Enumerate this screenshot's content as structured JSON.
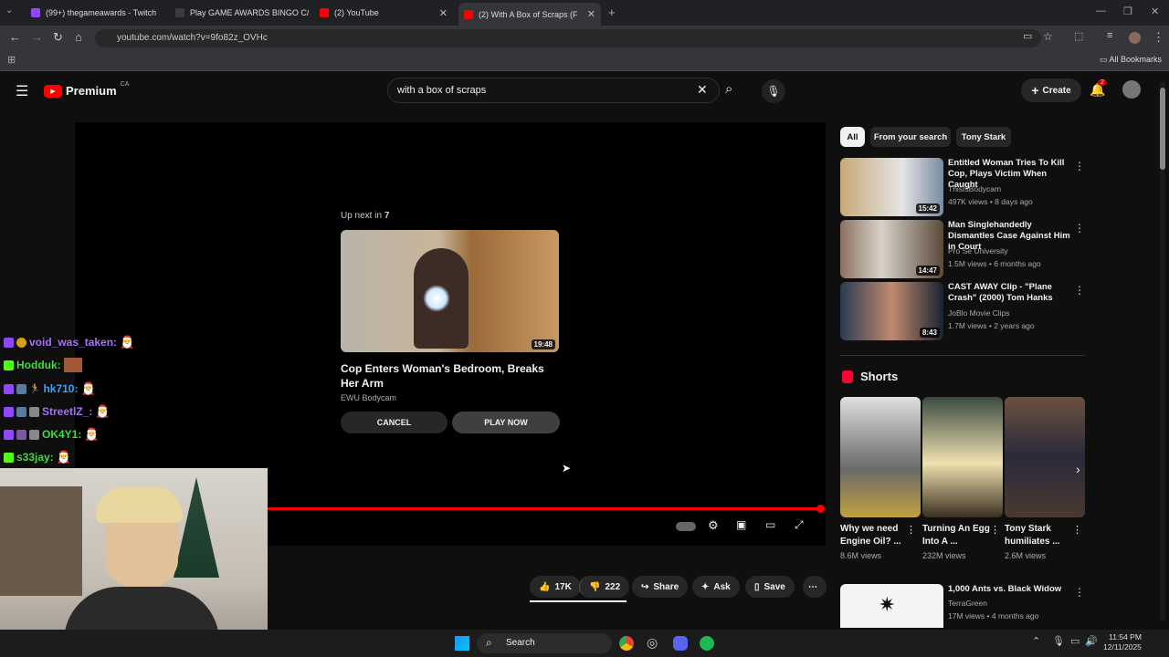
{
  "browser": {
    "tabs": [
      {
        "title": "(99+) thegameawards - Twitch",
        "color": "#9146ff"
      },
      {
        "title": "Play GAME AWARDS BINGO C/",
        "color": "#3c3c3c"
      },
      {
        "title": "(2) YouTube",
        "color": "#ff0000"
      },
      {
        "title": "(2) With A Box of Scraps (F",
        "color": "#ff0000"
      }
    ],
    "url": "youtube.com/watch?v=9fo82z_OVHc",
    "bookmarks_label": "All Bookmarks"
  },
  "youtube": {
    "brand": "Premium",
    "region": "CA",
    "search_value": "with a box of scraps",
    "create_label": "Create",
    "notif_count": "2"
  },
  "player": {
    "up_next_prefix": "Up next in",
    "up_next_seconds": "7",
    "next_title": "Cop Enters Woman's Bedroom, Breaks Her Arm",
    "next_channel": "EWU Bodycam",
    "next_duration": "19:48",
    "cancel_label": "CANCEL",
    "play_label": "PLAY NOW",
    "progress_fraction": 1.0
  },
  "actions": {
    "likes": "17K",
    "dislikes": "222",
    "share": "Share",
    "ask": "Ask",
    "save": "Save"
  },
  "chips": [
    "All",
    "From your search",
    "Tony Stark"
  ],
  "related": [
    {
      "title": "Entitled Woman Tries To Kill Cop, Plays Victim When Caught",
      "channel": "ThisIsBodycam",
      "meta": "497K views • 8 days ago",
      "duration": "15:42"
    },
    {
      "title": "Man Singlehandedly Dismantles Case Against Him in Court",
      "channel": "Pro Se University",
      "meta": "1.5M views • 6 months ago",
      "duration": "14:47"
    },
    {
      "title": "CAST AWAY Clip - \"Plane Crash\" (2000) Tom Hanks",
      "channel": "JoBlo Movie Clips",
      "meta": "1.7M views • 2 years ago",
      "duration": "8:43"
    }
  ],
  "shorts": {
    "heading": "Shorts",
    "items": [
      {
        "title": "Why we need Engine Oil? ...",
        "views": "8.6M views"
      },
      {
        "title": "Turning An Egg Into A ...",
        "views": "232M views"
      },
      {
        "title": "Tony Stark humiliates ...",
        "views": "2.6M views"
      }
    ]
  },
  "related_after": {
    "title": "1,000 Ants vs. Black Widow",
    "channel": "TerraGreen",
    "meta": "17M views • 4 months ago"
  },
  "chat": [
    {
      "user": "void_was_taken:",
      "color": "#a970ff"
    },
    {
      "user": "Hodduk:",
      "color": "#3dde3d"
    },
    {
      "user": "hk710:",
      "color": "#3fa4ff"
    },
    {
      "user": "StreetlZ_:",
      "color": "#a970ff"
    },
    {
      "user": "OK4Y1:",
      "color": "#3dde3d"
    },
    {
      "user": "s33jay:",
      "color": "#3dde3d"
    }
  ],
  "taskbar": {
    "search_label": "Search",
    "time": "11:54 PM",
    "date": "12/11/2025"
  }
}
